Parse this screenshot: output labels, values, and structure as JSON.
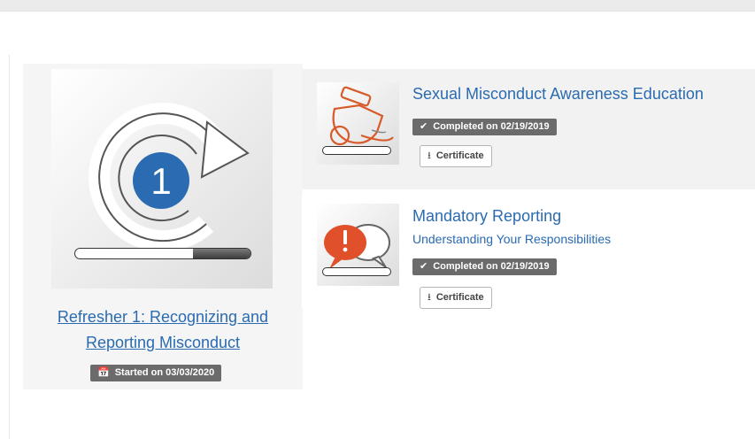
{
  "course": {
    "title_line1": "Refresher 1: Recognizing and",
    "title_line2": "Reporting Misconduct",
    "status": "Started on 03/03/2020",
    "progress_fraction": 0.33
  },
  "modules": [
    {
      "title": "Sexual Misconduct Awareness Education",
      "status": "Completed on 02/19/2019",
      "certificate_label": "Certificate"
    },
    {
      "title": "Mandatory Reporting",
      "subtitle": "Understanding Your Responsibilities",
      "status": "Completed on 02/19/2019",
      "certificate_label": "Certificate"
    }
  ],
  "icons": {
    "course": "refresh-one-icon",
    "module1": "whistle-icon",
    "module2": "speech-bubbles-icon",
    "completed": "check-icon",
    "started": "calendar-icon",
    "download": "download-icon"
  },
  "colors": {
    "link": "#2a6bb1",
    "tag": "#6b6b6b",
    "badge_blue": "#2a6bb1",
    "accent_orange": "#e0502a"
  }
}
